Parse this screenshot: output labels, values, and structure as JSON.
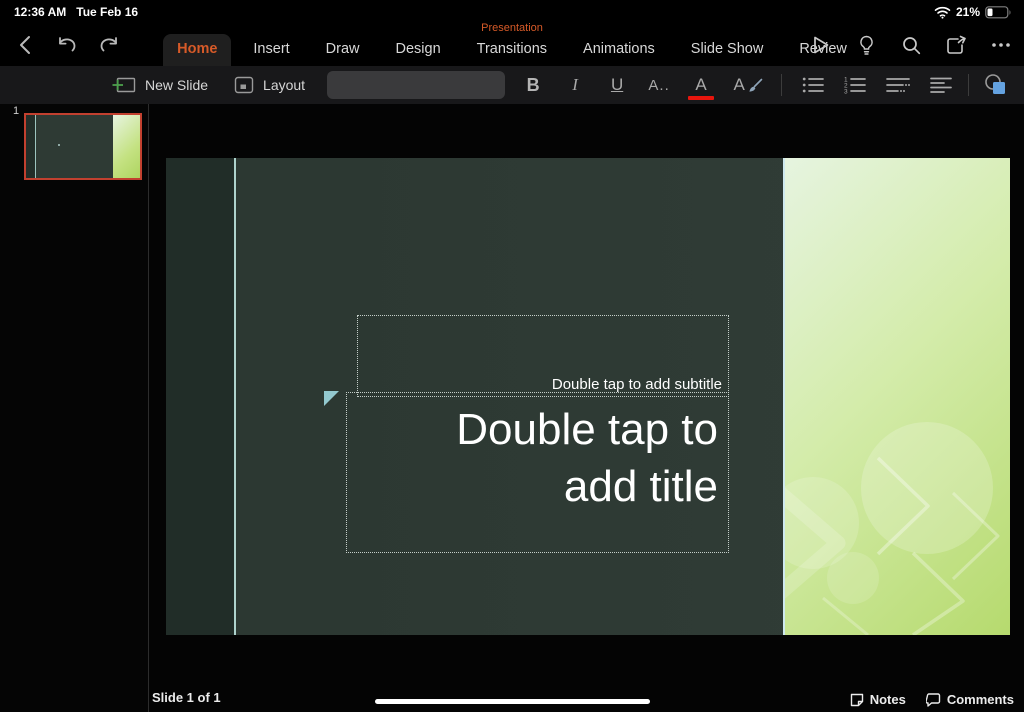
{
  "status": {
    "time": "12:36 AM",
    "date": "Tue Feb 16",
    "battery_percent": "21%"
  },
  "titlebar": {
    "document_state": "Presentation"
  },
  "tabs": [
    "Home",
    "Insert",
    "Draw",
    "Design",
    "Transitions",
    "Animations",
    "Slide Show",
    "Review"
  ],
  "active_tab": "Home",
  "ribbon": {
    "new_slide_label": "New Slide",
    "layout_label": "Layout",
    "font_field_value": "",
    "bold_label": "B",
    "italic_label": "I",
    "underline_label": "U",
    "font_size_label": "A..",
    "font_color_label": "A",
    "text_effects_label": "A"
  },
  "slides_panel": {
    "slide_number": "1"
  },
  "slide": {
    "subtitle_placeholder": "Double tap to add subtitle",
    "title_line1": "Double tap to",
    "title_line2": "add title"
  },
  "bottom_bar": {
    "slide_counter": "Slide 1 of 1",
    "notes_label": "Notes",
    "comments_label": "Comments"
  },
  "colors": {
    "accent": "#d65a28",
    "red_underline": "#e8150d",
    "shape_blue": "#64a2e0",
    "selection_red": "#c2402f"
  }
}
